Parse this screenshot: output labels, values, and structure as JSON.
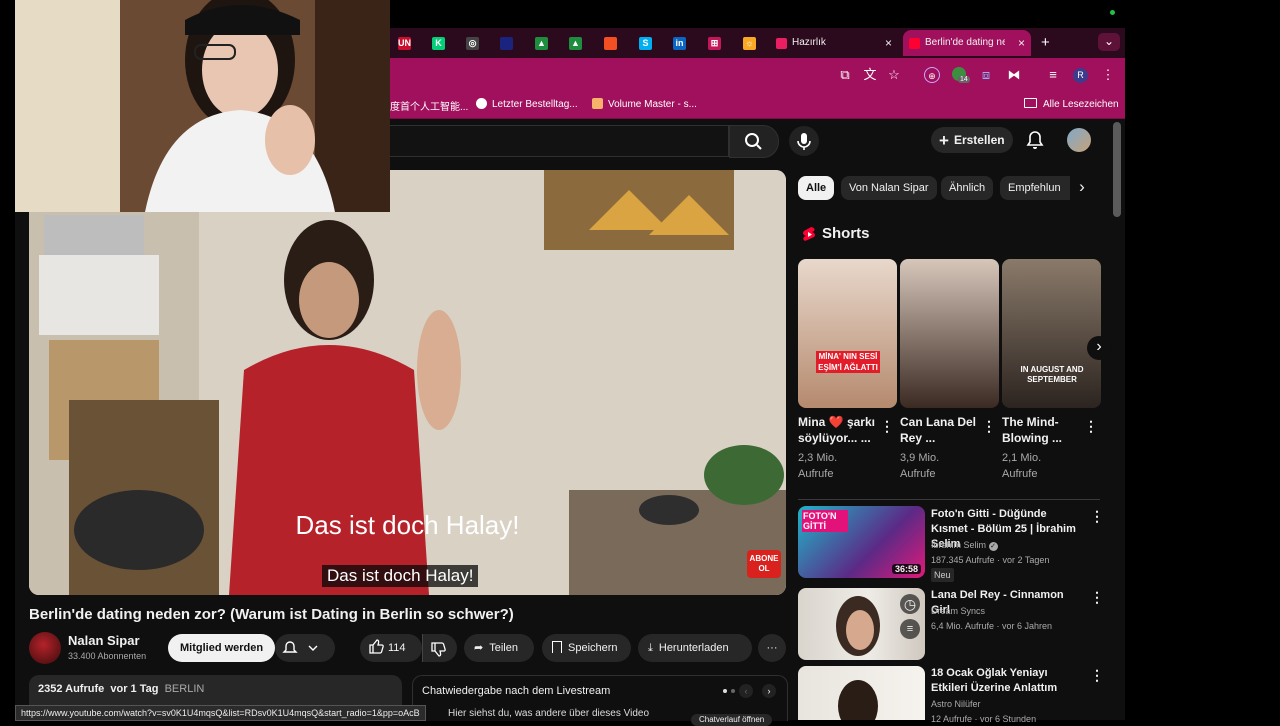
{
  "tabs": {
    "inactive_favicons": [
      {
        "icon": "unk-icon",
        "text": "UN",
        "color": "#c8102e"
      },
      {
        "icon": "kickstarter-icon",
        "text": "K",
        "color": "#05ce78"
      },
      {
        "icon": "openai-icon",
        "text": "◎",
        "color": "#444444"
      },
      {
        "icon": "flag-icon",
        "text": "",
        "color": "#1a237e"
      },
      {
        "icon": "drive-icon",
        "text": "▲",
        "color": "#1e8e3e"
      },
      {
        "icon": "drive-icon",
        "text": "▲",
        "color": "#1e8e3e"
      },
      {
        "icon": "microsoft-icon",
        "text": "",
        "color": "#f25022"
      },
      {
        "icon": "skype-icon",
        "text": "S",
        "color": "#00aff0"
      },
      {
        "icon": "linkedin-icon",
        "text": "in",
        "color": "#0a66c2"
      },
      {
        "icon": "grid-icon",
        "text": "⊞",
        "color": "#c2185b"
      },
      {
        "icon": "weather-icon",
        "text": "☼",
        "color": "#f9a825"
      }
    ],
    "hazirlik": {
      "label": "Hazırlık",
      "close": "×"
    },
    "active": {
      "label": "Berlin'de dating ne",
      "close": "×"
    },
    "new_tab": "+",
    "tab_menu": "⌄"
  },
  "toolbar": {
    "profile_letter": "R",
    "badge_count": "14"
  },
  "bookmarks": {
    "items": [
      {
        "label": "度首个人工智能..."
      },
      {
        "label": "Letzter Bestelltag..."
      },
      {
        "label": "Volume Master - s..."
      }
    ],
    "all_bookmarks": "Alle Lesezeichen"
  },
  "youtube_header": {
    "create_label": "Erstellen"
  },
  "video": {
    "subtitle_large": "Das ist doch Halay!",
    "subtitle_caption": "Das ist doch Halay!",
    "abone_badge": "ABONE OL",
    "title": "Berlin'de dating neden zor? (Warum ist Dating in Berlin so schwer?)"
  },
  "channel": {
    "name": "Nalan Sipar",
    "subscribers": "33.400 Abonnenten",
    "join_label": "Mitglied werden"
  },
  "actions": {
    "likes": "114",
    "share": "Teilen",
    "save": "Speichern",
    "download": "Herunterladen",
    "more": "···"
  },
  "description": {
    "views": "2352 Aufrufe",
    "date": "vor 1 Tag",
    "location": "BERLIN"
  },
  "chat_replay": {
    "title": "Chatwiedergabe nach dem Livestream",
    "text": "Hier siehst du, was andere über dieses Video",
    "button": "Chatverlauf öffnen"
  },
  "status_url": "https://www.youtube.com/watch?v=sv0K1U4mqsQ&list=RDsv0K1U4mqsQ&start_radio=1&pp=oAcB",
  "chips": [
    "Alle",
    "Von Nalan Sipar",
    "Ähnlich",
    "Empfehlun"
  ],
  "shorts": {
    "heading": "Shorts",
    "items": [
      {
        "title": "Mina ❤️ şarkı söylüyor... ...",
        "views": "2,3 Mio.",
        "unit": "Aufrufe",
        "overlay": "MİNA' NIN SESİ EŞİM'İ AĞLATTI",
        "colors": [
          "#e8d8cc",
          "#b58a6e"
        ]
      },
      {
        "title": "Can Lana Del Rey ...",
        "views": "3,9 Mio.",
        "unit": "Aufrufe",
        "overlay": "",
        "colors": [
          "#d7c7bb",
          "#3a2a22"
        ]
      },
      {
        "title": "The Mind-Blowing ...",
        "views": "2,1 Mio.",
        "unit": "Aufrufe",
        "overlay": "IN AUGUST AND SEPTEMBER",
        "colors": [
          "#8a7a6a",
          "#2c2420"
        ]
      }
    ]
  },
  "recommendations": [
    {
      "title": "Foto'n Gitti - Düğünde Kısmet - Bölüm 25 | İbrahim Selim",
      "channel": "İbrahim Selim",
      "verified": true,
      "meta": "187.345 Aufrufe · vor 2 Tagen",
      "badge": "Neu",
      "duration": "36:58",
      "thumb_text": "FOTO'N GİTTİ"
    },
    {
      "title": "Lana Del Rey - Cinnamon Girl",
      "channel": "Dream Syncs",
      "verified": false,
      "meta": "6,4 Mio. Aufrufe · vor 6 Jahren",
      "badge": "",
      "duration": "",
      "thumb_text": ""
    },
    {
      "title": "18 Ocak Oğlak Yeniayı Etkileri Üzerine Anlattım",
      "channel": "Astro Nilüfer",
      "verified": false,
      "meta": "12 Aufrufe · vor 6 Stunden",
      "badge": "",
      "duration": "",
      "thumb_text": ""
    }
  ],
  "colors": {
    "chrome_tab_bg": "#2b0a1d",
    "chrome_toolbar": "#a0105c",
    "yt_bg": "#0f0f0f",
    "chip_bg": "#272727",
    "shorts_red": "#ff0033"
  }
}
